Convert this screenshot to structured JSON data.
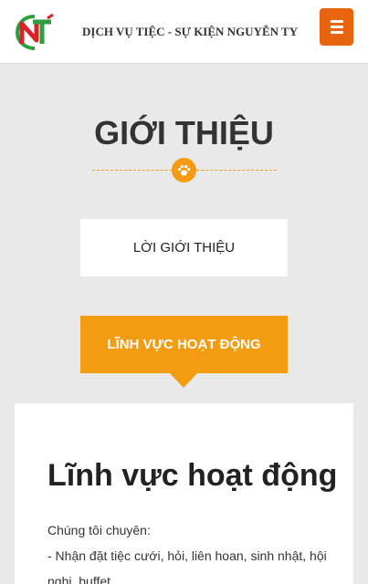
{
  "header": {
    "brand": "DỊCH VỤ TIỆC - SỰ KIỆN NGUYỄN TY",
    "logo_letters": "NT",
    "colors": {
      "accent": "#e8650f",
      "logo_red": "#d8232a",
      "logo_green": "#2e9e3e"
    }
  },
  "section": {
    "title": "GIỚI THIỆU",
    "icon": "paw-icon"
  },
  "tabs": [
    {
      "label": "LỜI GIỚI THIỆU",
      "active": false
    },
    {
      "label": "LĨNH VỰC HOẠT ĐỘNG",
      "active": true
    }
  ],
  "content": {
    "heading": "Lĩnh vực hoạt động",
    "intro": "Chúng tôi chuyên:",
    "line1": "- Nhận đặt tiệc cưới, hỏi, liên hoan, sinh nhật, hội nghị, buffet,..."
  },
  "colors": {
    "tab_active": "#f39c12",
    "background": "#e9e9e9"
  }
}
